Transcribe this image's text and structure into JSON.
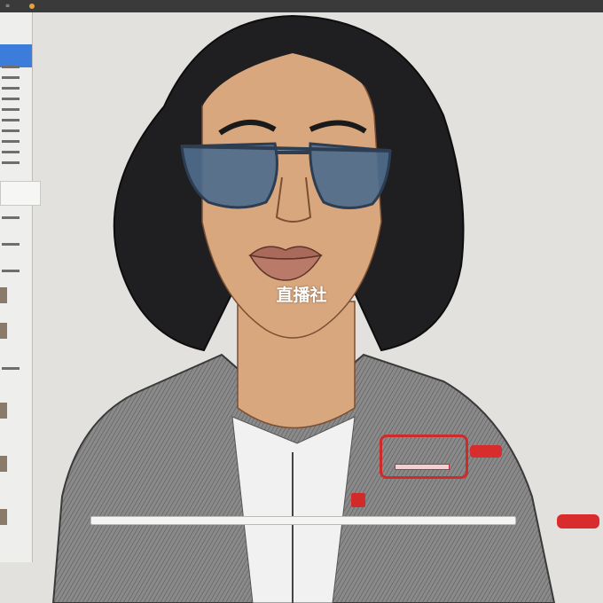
{
  "watermark": {
    "text": "直播社"
  },
  "colors": {
    "background": "#e2e1de",
    "hair": "#1f1f22",
    "skin": "#d9a77e",
    "sunglasses_lens": "#4e6c8c",
    "jacket": "#7a7a7a",
    "accent_red": "#d12a2a"
  }
}
